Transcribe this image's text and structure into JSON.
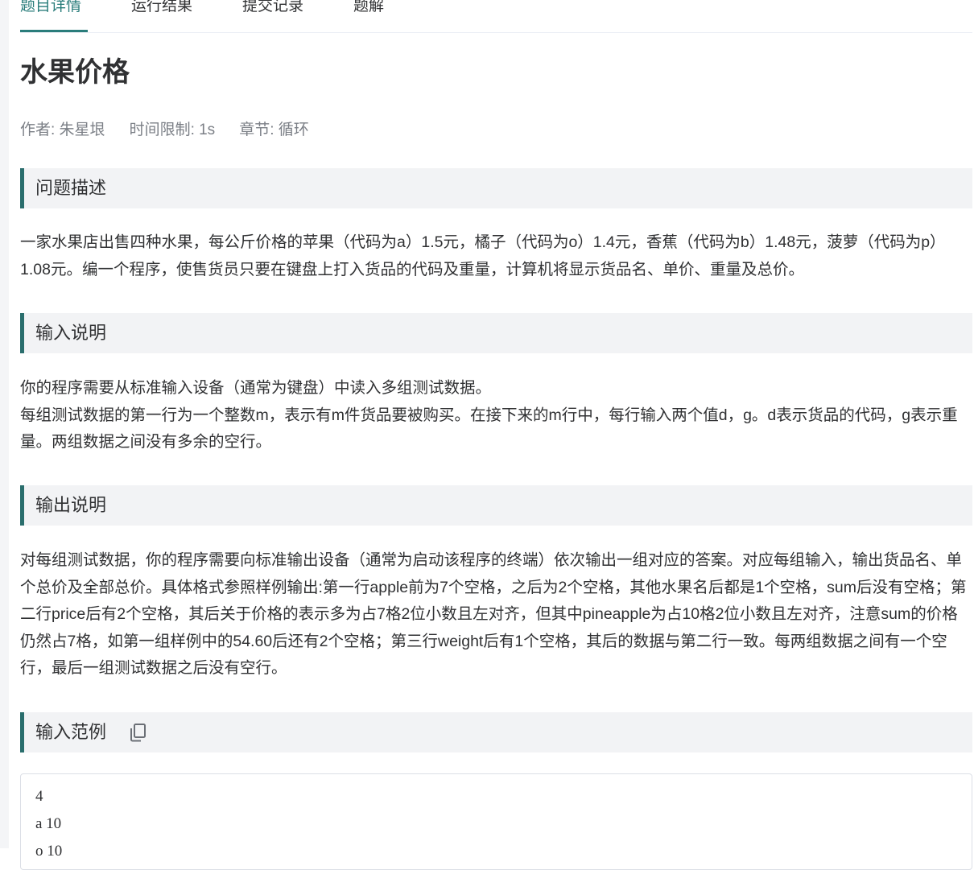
{
  "tabs": [
    {
      "label": "题目详情",
      "active": true
    },
    {
      "label": "运行结果",
      "active": false
    },
    {
      "label": "提交记录",
      "active": false
    },
    {
      "label": "题解",
      "active": false
    }
  ],
  "problem": {
    "title": "水果价格",
    "meta": {
      "author": "作者: 朱星垠",
      "time_limit": "时间限制: 1s",
      "chapter": "章节: 循环"
    }
  },
  "sections": {
    "description": {
      "heading": "问题描述",
      "text": "一家水果店出售四种水果，每公斤价格的苹果（代码为a）1.5元，橘子（代码为o）1.4元，香蕉（代码为b）1.48元，菠萝（代码为p）1.08元。编一个程序，使售货员只要在键盘上打入货品的代码及重量，计算机将显示货品名、单价、重量及总价。"
    },
    "input": {
      "heading": "输入说明",
      "line1": "你的程序需要从标准输入设备（通常为键盘）中读入多组测试数据。",
      "line2": "每组测试数据的第一行为一个整数m，表示有m件货品要被购买。在接下来的m行中，每行输入两个值d，g。d表示货品的代码，g表示重量。两组数据之间没有多余的空行。"
    },
    "output": {
      "heading": "输出说明",
      "text": "对每组测试数据，你的程序需要向标准输出设备（通常为启动该程序的终端）依次输出一组对应的答案。对应每组输入，输出货品名、单个总价及全部总价。具体格式参照样例输出:第一行apple前为7个空格，之后为2个空格，其他水果名后都是1个空格，sum后没有空格；第二行price后有2个空格，其后关于价格的表示多为占7格2位小数且左对齐，但其中pineapple为占10格2位小数且左对齐，注意sum的价格仍然占7格，如第一组样例中的54.60后还有2个空格；第三行weight后有1个空格，其后的数据与第二行一致。每两组数据之间有一个空行，最后一组测试数据之后没有空行。"
    },
    "sample_input": {
      "heading": "输入范例",
      "copy_icon": "copy-icon",
      "lines": [
        "4",
        "a 10",
        "o 10"
      ]
    }
  },
  "colors": {
    "accent": "#2a7d7b",
    "section_border": "#2a6e6d",
    "section_bg": "#f2f3f5",
    "meta_text": "#7b7f86"
  }
}
